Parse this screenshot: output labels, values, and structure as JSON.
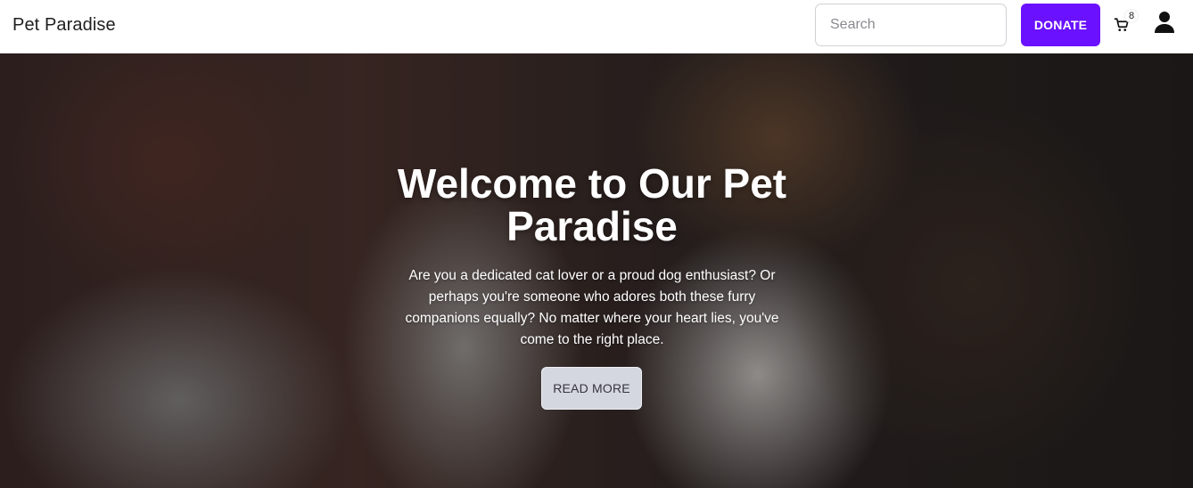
{
  "navbar": {
    "brand": "Pet Paradise",
    "search_placeholder": "Search",
    "donate_label": "DONATE",
    "cart_count": "8",
    "cart_icon": "cart-icon",
    "user_icon": "user-icon",
    "accent_color": "#6a11ff"
  },
  "hero": {
    "title": "Welcome to Our Pet Paradise",
    "text": "Are you a dedicated cat lover or a proud dog enthusiast? Or perhaps you're someone who adores both these furry companions equally? No matter where your heart lies, you've come to the right place.",
    "read_more_label": "READ MORE"
  }
}
